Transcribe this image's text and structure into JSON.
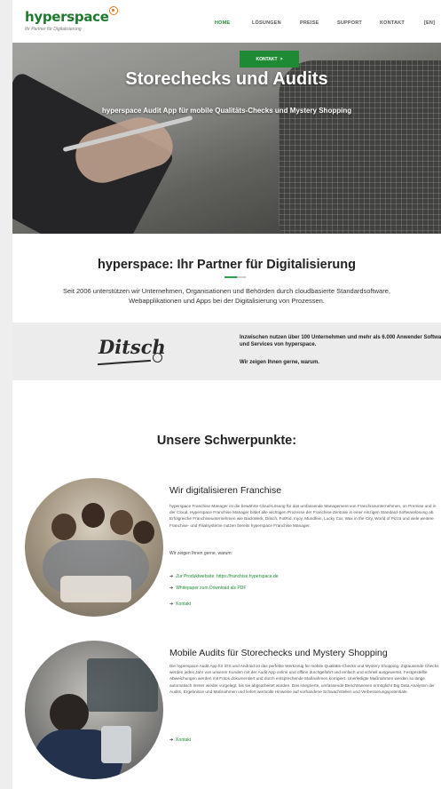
{
  "header": {
    "logo_text": "hyperspace",
    "logo_tagline": "Ihr Partner für Digitalisierung",
    "nav": [
      {
        "label": "HOME",
        "active": true
      },
      {
        "label": "LÖSUNGEN",
        "active": false
      },
      {
        "label": "PREISE",
        "active": false
      },
      {
        "label": "SUPPORT",
        "active": false
      },
      {
        "label": "KONTAKT",
        "active": false
      },
      {
        "label": "[EN]",
        "active": false
      }
    ]
  },
  "hero": {
    "title": "Storechecks und Audits",
    "subtitle": "hyperspace Audit App für mobile Qualitäts-Checks und Mystery Shopping"
  },
  "partner": {
    "title": "hyperspace: Ihr Partner für Digitalisierung",
    "description": "Seit 2006 unterstützen wir Unternehmen, Organisationen und Behörden durch cloudbasierte Standardsoftware, Webapplikationen und Apps bei der Digitalisierung von Prozessen."
  },
  "strip": {
    "logo": "Ditsch",
    "text": "Inzwischen nutzen über 100 Unternehmen und mehr als 6.000 Anwender Software und Services von hyperspace.",
    "subtext": "Wir zeigen Ihnen gerne, warum.",
    "button_label": "KONTAKT",
    "button_arrow": ">"
  },
  "focus": {
    "title": "Unsere Schwerpunkte:",
    "items": [
      {
        "title": "Wir digitalisieren Franchise",
        "body": "hyperspace Franchise Manager ist die bewährte Cloud-Lösung für das umfassende Management von Franchiseunternehmen, on Premise und in der Cloud. Hyperspace Franchise Manager bildet alle wichtigen Prozesse der Franchise-Zentrale in einer einzigen Standard-Softwarelösung ab. Erfolgreiche Franchiseunternehmen wie BackWerk, Ditsch, FotRid, Injoy, Mundfein, Lucky Car, Wax in the City, World of Pizza und viele weitere Franchise- und Filialsysteme nutzen bereits hyperspace Franchise Manager.",
        "line": "Wir zeigen Ihnen gerne, warum:",
        "links": [
          {
            "label": "Zur Produktwebsite: https://franchise.hyperspace.de",
            "arrow": "➔"
          },
          {
            "label": "Whitepaper zum Download als PDF",
            "arrow": "➔"
          },
          {
            "label": "Kontakt",
            "arrow": "➔"
          }
        ]
      },
      {
        "title": "Mobile Audits für Storechecks und Mystery Shopping",
        "body": "Die hyperspace Audit App für iOS und Android ist das perfekte Werkzeug für mobile Qualitäts-Checks und Mystery Shopping. Zigtausende Checks werden jedes Jahr von unseren Kunden mit der Audit App online und offline durchgeführt und einfach und schnell ausgewertet. Festgestellte Abweichungen werden mit Fotos dokumentiert und durch entsprechende Maßnahmen korrigiert. Unerledigte Maßnahmen werden so lange automatisch immer wieder vorgelegt, bis sie abgearbeitet wurden. Das integrierte, umfassende Berichtswesen ermöglicht Big Data Analysen der Audits, Ergebnisse und Maßnahmen und liefert wertvolle Hinweise auf vorhandene Schwachstellen und Verbesserungspotentiale.",
        "links": [
          {
            "label": "Kontakt",
            "arrow": "➔"
          }
        ]
      }
    ]
  },
  "colors": {
    "brand_green": "#1f8a34",
    "logo_accent": "#e8731a"
  }
}
